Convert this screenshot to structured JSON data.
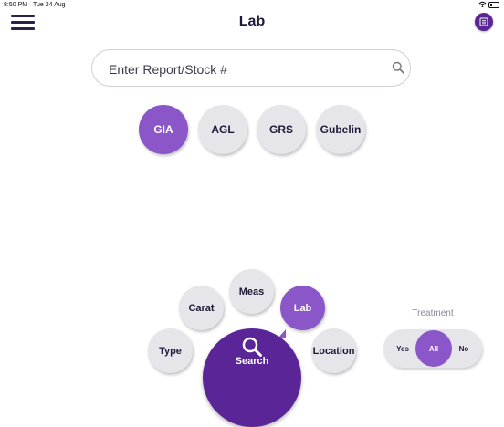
{
  "status_bar": {
    "time": "8:50 PM",
    "date": "Tue 24 Aug"
  },
  "header": {
    "title": "Lab"
  },
  "search": {
    "placeholder": "Enter Report/Stock #"
  },
  "lab_options": [
    {
      "label": "GIA",
      "selected": true
    },
    {
      "label": "AGL",
      "selected": false
    },
    {
      "label": "GRS",
      "selected": false
    },
    {
      "label": "Gubelin",
      "selected": false
    }
  ],
  "nav_menu": {
    "items": [
      {
        "label": "Type"
      },
      {
        "label": "Carat"
      },
      {
        "label": "Meas"
      },
      {
        "label": "Lab",
        "selected": true
      },
      {
        "label": "Location"
      }
    ],
    "center_label": "Search"
  },
  "treatment": {
    "title": "Treatment",
    "options": [
      "Yes",
      "All",
      "No"
    ],
    "selected": "All"
  },
  "colors": {
    "primary_dark": "#5a2596",
    "primary_light": "#8a56c8",
    "chip_bg": "#e6e6ea"
  }
}
